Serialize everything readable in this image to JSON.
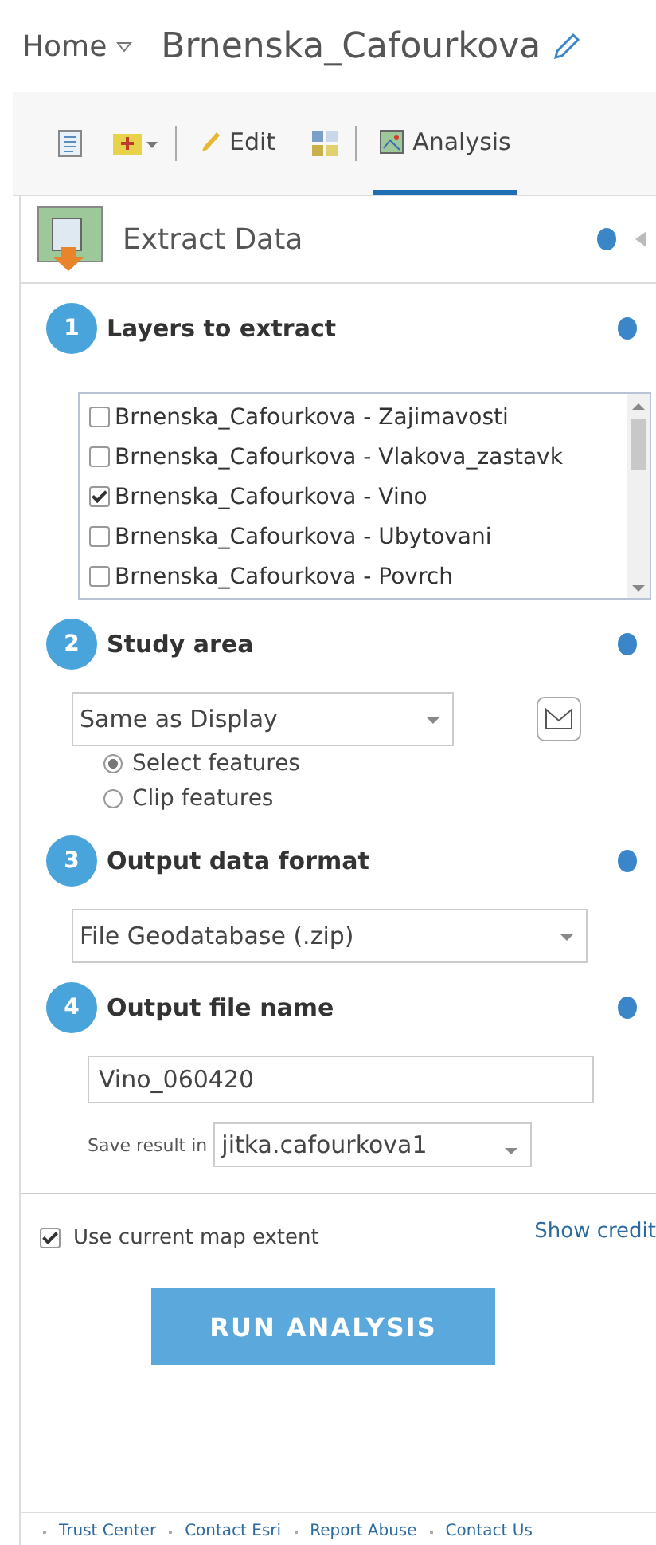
{
  "header": {
    "home": "Home",
    "title": "Brnenska_Cafourkova"
  },
  "toolbar": [
    {
      "label": "Edit",
      "selected": false
    },
    {
      "label": "Analysis",
      "selected": true
    }
  ],
  "tool": {
    "title": "Extract Data"
  },
  "steps": [
    {
      "number": "1",
      "title": "Layers to extract"
    },
    {
      "number": "2",
      "title": "Study area"
    },
    {
      "number": "3",
      "title": "Output data format"
    },
    {
      "number": "4",
      "title": "Output file name"
    }
  ],
  "layers": [
    {
      "label": "Brnenska_Cafourkova - Zajimavosti",
      "checked": false
    },
    {
      "label": "Brnenska_Cafourkova - Vlakova_zastavk",
      "checked": false
    },
    {
      "label": "Brnenska_Cafourkova - Vino",
      "checked": true
    },
    {
      "label": "Brnenska_Cafourkova - Ubytovani",
      "checked": false
    },
    {
      "label": "Brnenska_Cafourkova - Povrch",
      "checked": false
    }
  ],
  "study_area": {
    "value": "Same as Display",
    "options": [
      {
        "label": "Select features",
        "selected": true
      },
      {
        "label": "Clip features",
        "selected": false
      }
    ]
  },
  "format": {
    "value": "File Geodatabase (.zip)"
  },
  "file_name": {
    "value": "Vino_060420"
  },
  "save": {
    "label": "Save result in",
    "value": "jitka.cafourkova1"
  },
  "extent": {
    "label": "Use current map extent",
    "checked": true
  },
  "credits": "Show credit",
  "run_button": "RUN ANALYSIS",
  "footer": [
    "Trust Center",
    "Contact Esri",
    "Report Abuse",
    "Contact Us"
  ]
}
